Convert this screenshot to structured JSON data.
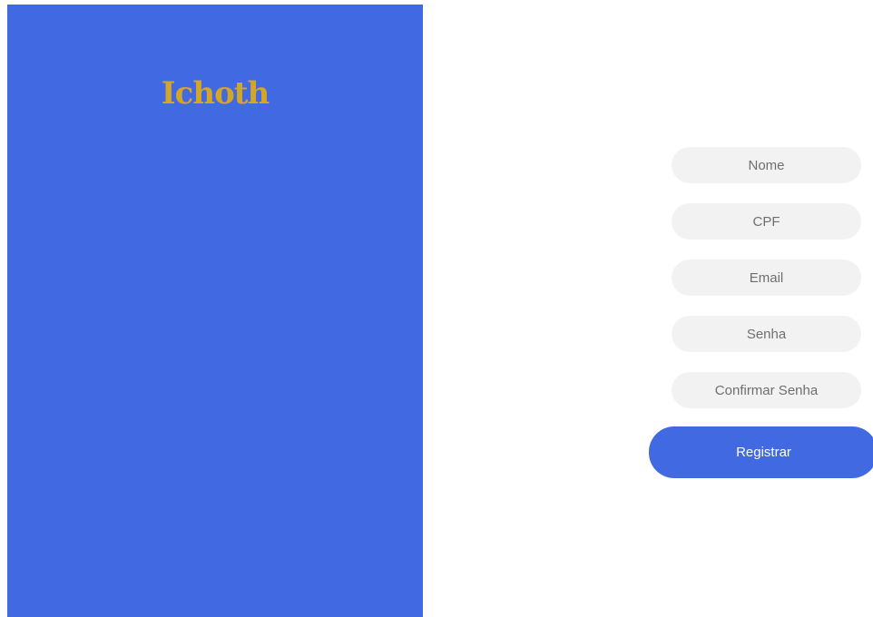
{
  "brand": {
    "logo_text": "Ichoth",
    "panel_color": "#4169e1",
    "logo_color": "#d4a628"
  },
  "form": {
    "fields": [
      {
        "placeholder": "Nome",
        "value": ""
      },
      {
        "placeholder": "CPF",
        "value": ""
      },
      {
        "placeholder": "Email",
        "value": ""
      },
      {
        "placeholder": "Senha",
        "value": ""
      },
      {
        "placeholder": "Confirmar Senha",
        "value": ""
      }
    ],
    "submit_label": "Registrar",
    "field_background": "#f2f2f2",
    "button_color": "#4169e1"
  }
}
